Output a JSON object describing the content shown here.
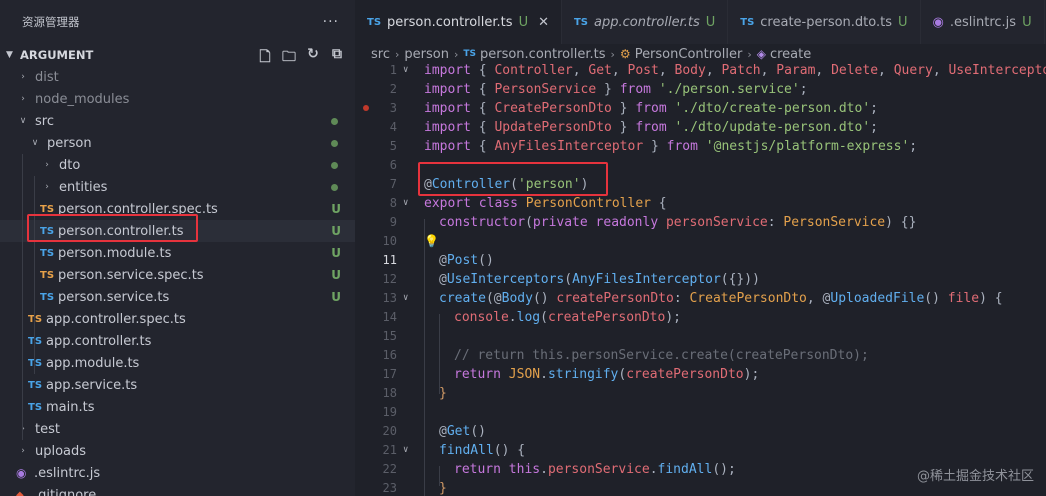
{
  "explorer": {
    "title": "资源管理器",
    "more": "···",
    "section": "ARGUMENT",
    "tree": [
      {
        "name": "dist",
        "kind": "folder",
        "open": false,
        "dim": true,
        "status": "",
        "indent": 0
      },
      {
        "name": "node_modules",
        "kind": "folder",
        "open": false,
        "dim": true,
        "status": "",
        "indent": 0
      },
      {
        "name": "src",
        "kind": "folder",
        "open": true,
        "dim": false,
        "status": "dot",
        "indent": 0
      },
      {
        "name": "person",
        "kind": "folder",
        "open": true,
        "dim": false,
        "status": "dot",
        "indent": 1
      },
      {
        "name": "dto",
        "kind": "folder",
        "open": false,
        "dim": false,
        "status": "dot",
        "indent": 2
      },
      {
        "name": "entities",
        "kind": "folder",
        "open": false,
        "dim": false,
        "status": "dot",
        "indent": 2
      },
      {
        "name": "person.controller.spec.ts",
        "kind": "ts-spec",
        "dim": false,
        "status": "U",
        "indent": 2
      },
      {
        "name": "person.controller.ts",
        "kind": "ts",
        "dim": false,
        "status": "U",
        "indent": 2,
        "selected": true
      },
      {
        "name": "person.module.ts",
        "kind": "ts",
        "dim": false,
        "status": "U",
        "indent": 2
      },
      {
        "name": "person.service.spec.ts",
        "kind": "ts-spec",
        "dim": false,
        "status": "U",
        "indent": 2
      },
      {
        "name": "person.service.ts",
        "kind": "ts",
        "dim": false,
        "status": "U",
        "indent": 2
      },
      {
        "name": "app.controller.spec.ts",
        "kind": "ts-spec",
        "dim": false,
        "status": "",
        "indent": 1
      },
      {
        "name": "app.controller.ts",
        "kind": "ts",
        "dim": false,
        "status": "",
        "indent": 1
      },
      {
        "name": "app.module.ts",
        "kind": "ts",
        "dim": false,
        "status": "",
        "indent": 1
      },
      {
        "name": "app.service.ts",
        "kind": "ts",
        "dim": false,
        "status": "",
        "indent": 1
      },
      {
        "name": "main.ts",
        "kind": "ts",
        "dim": false,
        "status": "",
        "indent": 1
      },
      {
        "name": "test",
        "kind": "folder",
        "open": false,
        "dim": false,
        "status": "",
        "indent": 0
      },
      {
        "name": "uploads",
        "kind": "folder",
        "open": false,
        "dim": false,
        "status": "",
        "indent": 0
      },
      {
        "name": ".eslintrc.js",
        "kind": "eslint",
        "dim": false,
        "status": "",
        "indent": 0
      },
      {
        "name": ".gitignore",
        "kind": "git",
        "dim": false,
        "status": "",
        "indent": 0
      }
    ]
  },
  "tabs": [
    {
      "label": "person.controller.ts",
      "status": "U",
      "active": true,
      "italic": false,
      "icon": "TS",
      "close": "✕"
    },
    {
      "label": "app.controller.ts",
      "status": "U",
      "active": false,
      "italic": true,
      "icon": "TS"
    },
    {
      "label": "create-person.dto.ts",
      "status": "U",
      "active": false,
      "italic": false,
      "icon": "TS"
    },
    {
      "label": ".eslintrc.js",
      "status": "U",
      "active": false,
      "italic": false,
      "icon": "eslint"
    }
  ],
  "breadcrumb": [
    "src",
    "person",
    "person.controller.ts",
    "PersonController",
    "create"
  ],
  "code": [
    {
      "n": "1",
      "fold": "v",
      "indent": 0,
      "segs": [
        [
          "kw",
          "import"
        ],
        [
          "pl",
          " { "
        ],
        [
          "vr",
          "Controller"
        ],
        [
          "pl",
          ", "
        ],
        [
          "vr",
          "Get"
        ],
        [
          "pl",
          ", "
        ],
        [
          "vr",
          "Post"
        ],
        [
          "pl",
          ", "
        ],
        [
          "vr",
          "Body"
        ],
        [
          "pl",
          ", "
        ],
        [
          "vr",
          "Patch"
        ],
        [
          "pl",
          ", "
        ],
        [
          "vr",
          "Param"
        ],
        [
          "pl",
          ", "
        ],
        [
          "vr",
          "Delete"
        ],
        [
          "pl",
          ", "
        ],
        [
          "vr",
          "Query"
        ],
        [
          "pl",
          ", "
        ],
        [
          "vr",
          "UseInterceptors"
        ]
      ]
    },
    {
      "n": "2",
      "indent": 0,
      "segs": [
        [
          "kw",
          "import"
        ],
        [
          "pl",
          " { "
        ],
        [
          "vr",
          "PersonService"
        ],
        [
          "pl",
          " } "
        ],
        [
          "kw",
          "from"
        ],
        [
          "pl",
          " "
        ],
        [
          "str",
          "'./person.service'"
        ],
        [
          "pl",
          ";"
        ]
      ]
    },
    {
      "n": "3",
      "indent": 0,
      "bp": true,
      "segs": [
        [
          "kw",
          "import"
        ],
        [
          "pl",
          " { "
        ],
        [
          "vr",
          "CreatePersonDto"
        ],
        [
          "pl",
          " } "
        ],
        [
          "kw",
          "from"
        ],
        [
          "pl",
          " "
        ],
        [
          "str",
          "'./dto/create-person.dto'"
        ],
        [
          "pl",
          ";"
        ]
      ]
    },
    {
      "n": "4",
      "indent": 0,
      "segs": [
        [
          "kw",
          "import"
        ],
        [
          "pl",
          " { "
        ],
        [
          "vr",
          "UpdatePersonDto"
        ],
        [
          "pl",
          " } "
        ],
        [
          "kw",
          "from"
        ],
        [
          "pl",
          " "
        ],
        [
          "str",
          "'./dto/update-person.dto'"
        ],
        [
          "pl",
          ";"
        ]
      ]
    },
    {
      "n": "5",
      "indent": 0,
      "segs": [
        [
          "kw",
          "import"
        ],
        [
          "pl",
          " { "
        ],
        [
          "vr",
          "AnyFilesInterceptor"
        ],
        [
          "pl",
          " } "
        ],
        [
          "kw",
          "from"
        ],
        [
          "pl",
          " "
        ],
        [
          "str",
          "'@nestjs/platform-express'"
        ],
        [
          "pl",
          ";"
        ]
      ]
    },
    {
      "n": "6",
      "indent": 0,
      "segs": []
    },
    {
      "n": "7",
      "indent": 0,
      "segs": [
        [
          "pl",
          "@"
        ],
        [
          "fn",
          "Controller"
        ],
        [
          "pl",
          "("
        ],
        [
          "str",
          "'person'"
        ],
        [
          "pl",
          ")"
        ]
      ]
    },
    {
      "n": "8",
      "fold": "v",
      "indent": 0,
      "segs": [
        [
          "kw",
          "export class "
        ],
        [
          "ty",
          "PersonController"
        ],
        [
          "pl",
          " {"
        ]
      ]
    },
    {
      "n": "9",
      "indent": 1,
      "segs": [
        [
          "kw",
          "constructor"
        ],
        [
          "pl",
          "("
        ],
        [
          "kw",
          "private readonly "
        ],
        [
          "vr",
          "personService"
        ],
        [
          "pl",
          ": "
        ],
        [
          "ty",
          "PersonService"
        ],
        [
          "pl",
          ") {}"
        ]
      ]
    },
    {
      "n": "10",
      "indent": 1,
      "bulb": true,
      "segs": []
    },
    {
      "n": "11",
      "indent": 1,
      "cur": true,
      "segs": [
        [
          "pl",
          "@"
        ],
        [
          "fn",
          "Post"
        ],
        [
          "pl",
          "()"
        ]
      ]
    },
    {
      "n": "12",
      "indent": 1,
      "segs": [
        [
          "pl",
          "@"
        ],
        [
          "fn",
          "UseInterceptors"
        ],
        [
          "pl",
          "("
        ],
        [
          "fn",
          "AnyFilesInterceptor"
        ],
        [
          "pl",
          "({}))"
        ]
      ]
    },
    {
      "n": "13",
      "fold": "v",
      "indent": 1,
      "segs": [
        [
          "fn",
          "create"
        ],
        [
          "pl",
          "(@"
        ],
        [
          "fn",
          "Body"
        ],
        [
          "pl",
          "() "
        ],
        [
          "vr",
          "createPersonDto"
        ],
        [
          "pl",
          ": "
        ],
        [
          "ty",
          "CreatePersonDto"
        ],
        [
          "pl",
          ", @"
        ],
        [
          "fn",
          "UploadedFile"
        ],
        [
          "pl",
          "() "
        ],
        [
          "vr",
          "file"
        ],
        [
          "pl",
          ") {"
        ]
      ]
    },
    {
      "n": "14",
      "indent": 2,
      "segs": [
        [
          "vr",
          "console"
        ],
        [
          "pl",
          "."
        ],
        [
          "fn",
          "log"
        ],
        [
          "pl",
          "("
        ],
        [
          "vr",
          "createPersonDto"
        ],
        [
          "pl",
          ");"
        ]
      ]
    },
    {
      "n": "15",
      "indent": 2,
      "segs": []
    },
    {
      "n": "16",
      "indent": 2,
      "segs": [
        [
          "cm",
          "// return this.personService.create(createPersonDto);"
        ]
      ]
    },
    {
      "n": "17",
      "indent": 2,
      "segs": [
        [
          "kw",
          "return "
        ],
        [
          "ty",
          "JSON"
        ],
        [
          "pl",
          "."
        ],
        [
          "fn",
          "stringify"
        ],
        [
          "pl",
          "("
        ],
        [
          "vr",
          "createPersonDto"
        ],
        [
          "pl",
          ");"
        ]
      ]
    },
    {
      "n": "18",
      "indent": 1,
      "segs": [
        [
          "pu",
          "}"
        ]
      ]
    },
    {
      "n": "19",
      "indent": 1,
      "segs": []
    },
    {
      "n": "20",
      "indent": 1,
      "segs": [
        [
          "pl",
          "@"
        ],
        [
          "fn",
          "Get"
        ],
        [
          "pl",
          "()"
        ]
      ]
    },
    {
      "n": "21",
      "fold": "v",
      "indent": 1,
      "segs": [
        [
          "fn",
          "findAll"
        ],
        [
          "pl",
          "() {"
        ]
      ]
    },
    {
      "n": "22",
      "indent": 2,
      "segs": [
        [
          "kw",
          "return "
        ],
        [
          "kw",
          "this"
        ],
        [
          "pl",
          "."
        ],
        [
          "vr",
          "personService"
        ],
        [
          "pl",
          "."
        ],
        [
          "fn",
          "findAll"
        ],
        [
          "pl",
          "();"
        ]
      ]
    },
    {
      "n": "23",
      "indent": 1,
      "segs": [
        [
          "pu",
          "}"
        ]
      ]
    }
  ],
  "watermark": "@稀土掘金技术社区"
}
